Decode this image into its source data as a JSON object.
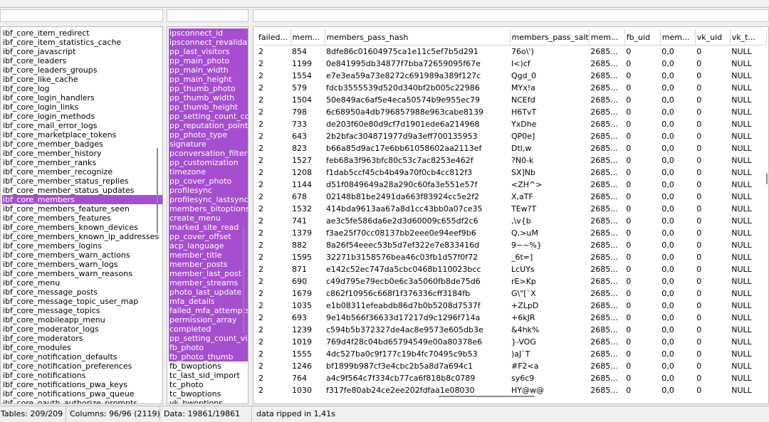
{
  "tables": [
    "ibf_core_item_redirect",
    "ibf_core_item_statistics_cache",
    "ibf_core_javascript",
    "ibf_core_leaders",
    "ibf_core_leaders_groups",
    "ibf_core_like_cache",
    "ibf_core_log",
    "ibf_core_login_handlers",
    "ibf_core_login_links",
    "ibf_core_login_methods",
    "ibf_core_mail_error_logs",
    "ibf_core_marketplace_tokens",
    "ibf_core_member_badges",
    "ibf_core_member_history",
    "ibf_core_member_ranks",
    "ibf_core_member_recognize",
    "ibf_core_member_status_replies",
    "ibf_core_member_status_updates",
    "ibf_core_members",
    "ibf_core_members_feature_seen",
    "ibf_core_members_features",
    "ibf_core_members_known_devices",
    "ibf_core_members_known_ip_addresses",
    "ibf_core_members_logins",
    "ibf_core_members_warn_actions",
    "ibf_core_members_warn_logs",
    "ibf_core_members_warn_reasons",
    "ibf_core_menu",
    "ibf_core_message_posts",
    "ibf_core_message_topic_user_map",
    "ibf_core_message_topics",
    "ibf_core_mobileapp_menu",
    "ibf_core_moderator_logs",
    "ibf_core_moderators",
    "ibf_core_modules",
    "ibf_core_notification_defaults",
    "ibf_core_notification_preferences",
    "ibf_core_notifications",
    "ibf_core_notifications_pwa_keys",
    "ibf_core_notifications_pwa_queue",
    "ibf_core_oauth_authorize_prompts"
  ],
  "selected_table_index": 18,
  "columns": [
    "ipsconnect_id",
    "ipsconnect_revalidate_url",
    "pp_last_visitors",
    "pp_main_photo",
    "pp_main_width",
    "pp_main_height",
    "pp_thumb_photo",
    "pp_thumb_width",
    "pp_thumb_height",
    "pp_setting_count_comments",
    "pp_reputation_points",
    "pp_photo_type",
    "signature",
    "pconversation_filters",
    "pp_customization",
    "timezone",
    "pp_cover_photo",
    "profilesync",
    "profilesync_lastsync",
    "members_bitoptions",
    "create_menu",
    "marked_site_read",
    "pp_cover_offset",
    "acp_language",
    "member_title",
    "member_posts",
    "member_last_post",
    "member_streams",
    "photo_last_update",
    "mfa_details",
    "failed_mfa_attempts",
    "permission_array",
    "completed",
    "pp_setting_count_visitors",
    "fb_photo",
    "fb_photo_thumb",
    "fb_bwoptions",
    "tc_last_sid_import",
    "tc_photo",
    "tc_bwoptions",
    "vk_bwoptions"
  ],
  "selected_columns_count": 36,
  "grid": {
    "headers": [
      "failed...",
      "mem...",
      "members_pass_hash",
      "members_pass_salt",
      "mem...",
      "fb_uid",
      "mem...",
      "vk_uid",
      "vk_t..."
    ],
    "rows": [
      [
        "2",
        "854",
        "8dfe86c01604975ca1e11c5ef7b5d291",
        "76o\\')",
        "2685...",
        "0",
        "0,0",
        "0",
        "NULL"
      ],
      [
        "2",
        "1199",
        "0e841995db34877f7bba72659095f67e",
        "I<)cf",
        "2685...",
        "0",
        "0,0",
        "0",
        "NULL"
      ],
      [
        "2",
        "1554",
        "e7e3ea59a73e8272c691989a389f127c",
        "Qgd_0",
        "2685...",
        "0",
        "0,0",
        "0",
        "NULL"
      ],
      [
        "2",
        "579",
        "fdcb3555539d520d340bf2b005c22986",
        "MYx!a",
        "2685...",
        "0",
        "0,0",
        "0",
        "NULL"
      ],
      [
        "2",
        "1504",
        "50e849ac6af5e4eca50574b9e955ec79",
        "NCEfd",
        "2685...",
        "0",
        "0,0",
        "0",
        "NULL"
      ],
      [
        "2",
        "798",
        "6c68950a4db796857988e963cabe8139",
        "H6TvT",
        "2685...",
        "0",
        "0,0",
        "0",
        "NULL"
      ],
      [
        "2",
        "733",
        "de203f60e80d9cf7d1901ede6a214968",
        "YxDhe",
        "2685...",
        "0",
        "0,0",
        "0",
        "NULL"
      ],
      [
        "2",
        "643",
        "2b2bfac304871977d9a3eff700135953",
        "QP0e]",
        "2685...",
        "0",
        "0,0",
        "0",
        "NULL"
      ],
      [
        "2",
        "823",
        "b66a85d9ac17e6bb61058602aa2113ef",
        "Dtl,w",
        "2685...",
        "0",
        "0,0",
        "0",
        "NULL"
      ],
      [
        "2",
        "1527",
        "feb68a3f963bfc80c53c7ac8253e462f",
        "?N0-k",
        "2685...",
        "0",
        "0,0",
        "0",
        "NULL"
      ],
      [
        "2",
        "1208",
        "f1dab5ccf45cb4b49a70f0cb4cc812f3",
        "SX]Nb",
        "2685...",
        "0",
        "0,0",
        "0",
        "NULL"
      ],
      [
        "2",
        "1144",
        "d51f0849649a28a290c60fa3e551e57f",
        "<ZH^>",
        "2685...",
        "0",
        "0,0",
        "0",
        "NULL"
      ],
      [
        "2",
        "678",
        "02148b81be2491da663f83924cc5e2f2",
        "X,aTF",
        "2685...",
        "0",
        "0,0",
        "0",
        "NULL"
      ],
      [
        "2",
        "1532",
        "414bda9613aa67a8d1cc43bb0a07ce35",
        "TEw?T",
        "2685...",
        "0",
        "0,0",
        "0",
        "NULL"
      ],
      [
        "2",
        "741",
        "ae3c5fe586da6e2d3d60009c655df2c6",
        ",\\v{b",
        "2685...",
        "0",
        "0,0",
        "0",
        "NULL"
      ],
      [
        "2",
        "1379",
        "f3ae25f70cc08137bb2eee0e94eef9b6",
        "Q,>uM",
        "2685...",
        "0",
        "0,0",
        "0",
        "NULL"
      ],
      [
        "2",
        "882",
        "8a26f54eeec53b5d7ef322e7e833416d",
        "9~~%}",
        "2685...",
        "0",
        "0,0",
        "0",
        "NULL"
      ],
      [
        "2",
        "1595",
        "32271b3158576bea46c03fb1d57f0f72",
        "_6t=]",
        "2685...",
        "0",
        "0,0",
        "0",
        "NULL"
      ],
      [
        "2",
        "871",
        "e142c52ec747da5cbc0468b110023bcc",
        "LcUYs",
        "2685...",
        "0",
        "0,0",
        "0",
        "NULL"
      ],
      [
        "2",
        "690",
        "c49d795e79ecb0e6c3a5060fb8de75d6",
        "rE>Kp",
        "2685...",
        "0",
        "0,0",
        "0",
        "NULL"
      ],
      [
        "2",
        "1679",
        "c862f10956c668f1f376336cff3184fb",
        "G\\\"[`X",
        "2685...",
        "0",
        "0,0",
        "0",
        "NULL"
      ],
      [
        "2",
        "1035",
        "e1b08311efeabdb86d7b0b5208d7537f",
        "+ZLpD",
        "2685...",
        "0",
        "0,0",
        "0",
        "NULL"
      ],
      [
        "2",
        "693",
        "9e14b566f36633d17217d9c1296f714a",
        "+6kJR",
        "2685...",
        "0",
        "0,0",
        "0",
        "NULL"
      ],
      [
        "2",
        "1239",
        "c594b5b372327de4ac8e9573e605db3e",
        "&4hk%",
        "2685...",
        "0",
        "0,0",
        "0",
        "NULL"
      ],
      [
        "2",
        "1019",
        "769d4f28c04bd65794549e00a80378e6",
        "}-VOG",
        "2685...",
        "0",
        "0,0",
        "0",
        "NULL"
      ],
      [
        "2",
        "1555",
        "4dc527ba0c9f177c19b4fc70495c9b53",
        ")aJ`T",
        "2685...",
        "0",
        "0,0",
        "0",
        "NULL"
      ],
      [
        "2",
        "1246",
        "bf1899b987cf3e4cbc2b5a8d7a694c1",
        "#F2<a",
        "2685...",
        "0",
        "0,0",
        "0",
        "NULL"
      ],
      [
        "2",
        "764",
        "a4c9f564c7f334cb77ca6f818b8c0789",
        "sy6c9",
        "2685...",
        "0",
        "0,0",
        "0",
        "NULL"
      ],
      [
        "2",
        "1030",
        "f317fe80ab24ce2ee202fdfaa1e08030",
        "HY@w@",
        "2685...",
        "0",
        "0,0",
        "0",
        "NULL"
      ]
    ]
  },
  "status": {
    "tables": "Tables: 209/209",
    "columns": "Columns: 96/96 (2119)",
    "data": "Data: 19861/19861",
    "message": "data ripped in 1,41s"
  },
  "colors": {
    "selection": "#a64ed0"
  }
}
